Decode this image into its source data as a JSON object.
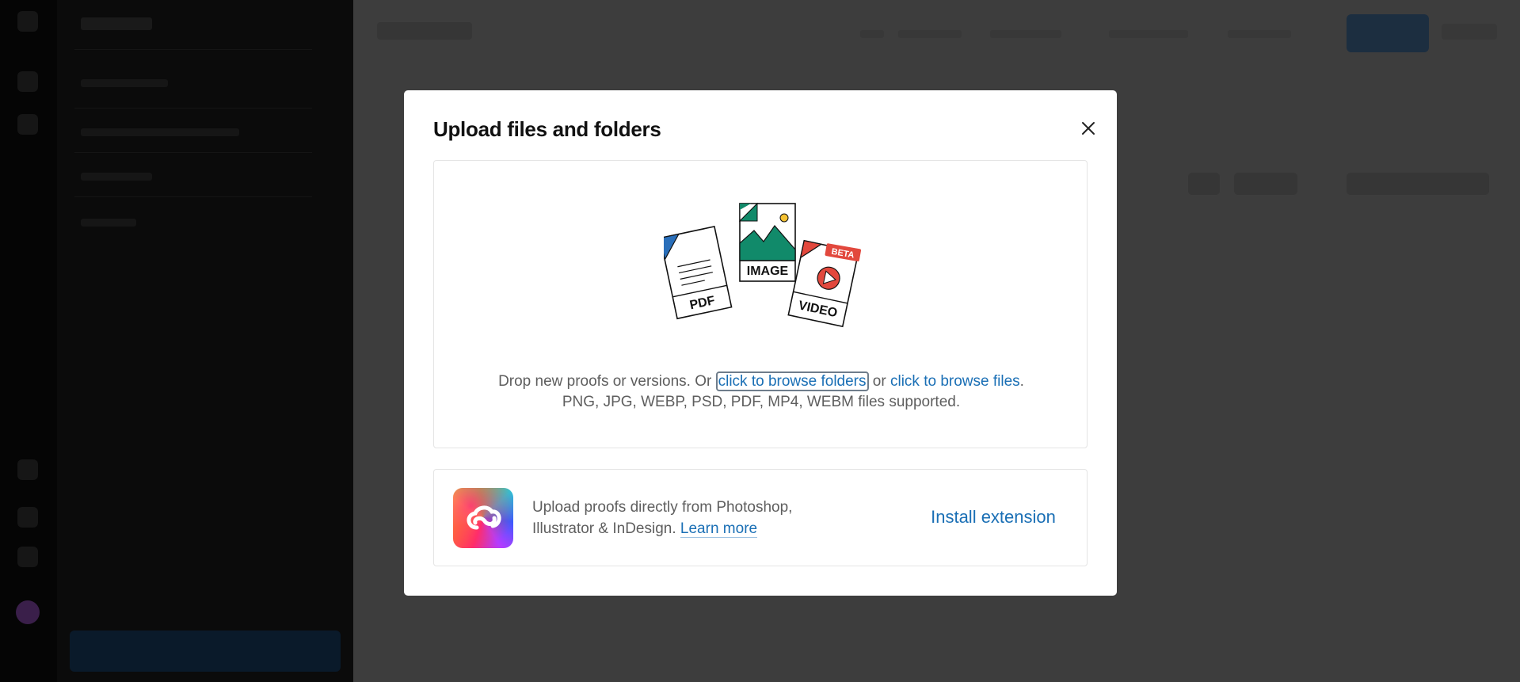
{
  "dialog": {
    "title": "Upload files and folders",
    "close_icon": "close-icon"
  },
  "dropzone": {
    "text_prefix": "Drop new proofs or versions. Or ",
    "browse_folders_link": "click to browse folders",
    "text_or": " or ",
    "browse_files_link": "click to browse files",
    "text_period": ".",
    "supported_formats": "PNG, JPG, WEBP, PSD, PDF, MP4, WEBM files supported.",
    "illustration": {
      "pdf_label": "PDF",
      "image_label": "IMAGE",
      "video_label": "VIDEO",
      "beta_badge": "BETA"
    }
  },
  "extension": {
    "logo_icon": "creative-cloud-logo-icon",
    "description_line1": "Upload proofs directly from Photoshop,",
    "description_line2": "Illustrator & InDesign. ",
    "learn_more_link": "Learn more",
    "install_button": "Install extension"
  },
  "colors": {
    "link": "#1a6fb5",
    "overlay": "#3d3d3d",
    "dialog_bg": "#ffffff",
    "pdf_corner": "#2a6fba",
    "image_green": "#118a6a",
    "video_red": "#e2483d"
  }
}
